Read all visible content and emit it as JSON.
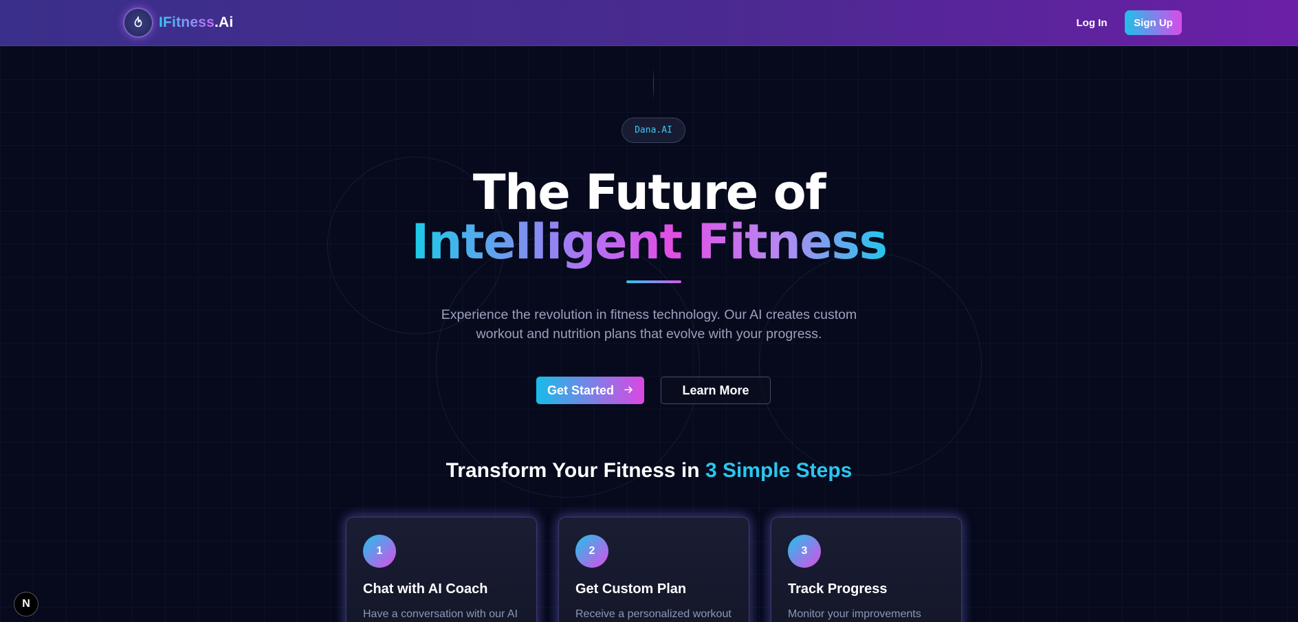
{
  "header": {
    "logo": {
      "brand_part1": "IFitness",
      "brand_part2": ".Ai",
      "icon": "flame-icon"
    },
    "login_label": "Log In",
    "signup_label": "Sign Up"
  },
  "hero": {
    "badge": "Dana.AI",
    "title_line1": "The Future of",
    "title_line2": "Intelligent Fitness",
    "description": "Experience the revolution in fitness technology. Our AI creates custom workout and nutrition plans that evolve with your progress.",
    "primary_cta": "Get Started",
    "primary_cta_icon": "arrow-right-icon",
    "secondary_cta": "Learn More"
  },
  "steps": {
    "title_prefix": "Transform Your Fitness in",
    "title_accent": "3 Simple Steps",
    "cards": [
      {
        "number": "1",
        "title": "Chat with AI Coach",
        "description": "Have a conversation with our AI"
      },
      {
        "number": "2",
        "title": "Get Custom Plan",
        "description": "Receive a personalized workout"
      },
      {
        "number": "3",
        "title": "Track Progress",
        "description": "Monitor your improvements"
      }
    ]
  },
  "floating_button": {
    "label": "N"
  },
  "colors": {
    "accent_cyan": "#1fc0e8",
    "accent_magenta": "#d94be8",
    "background": "#070a1c",
    "header_start": "#3a2f8a",
    "header_end": "#6a1fa6"
  }
}
